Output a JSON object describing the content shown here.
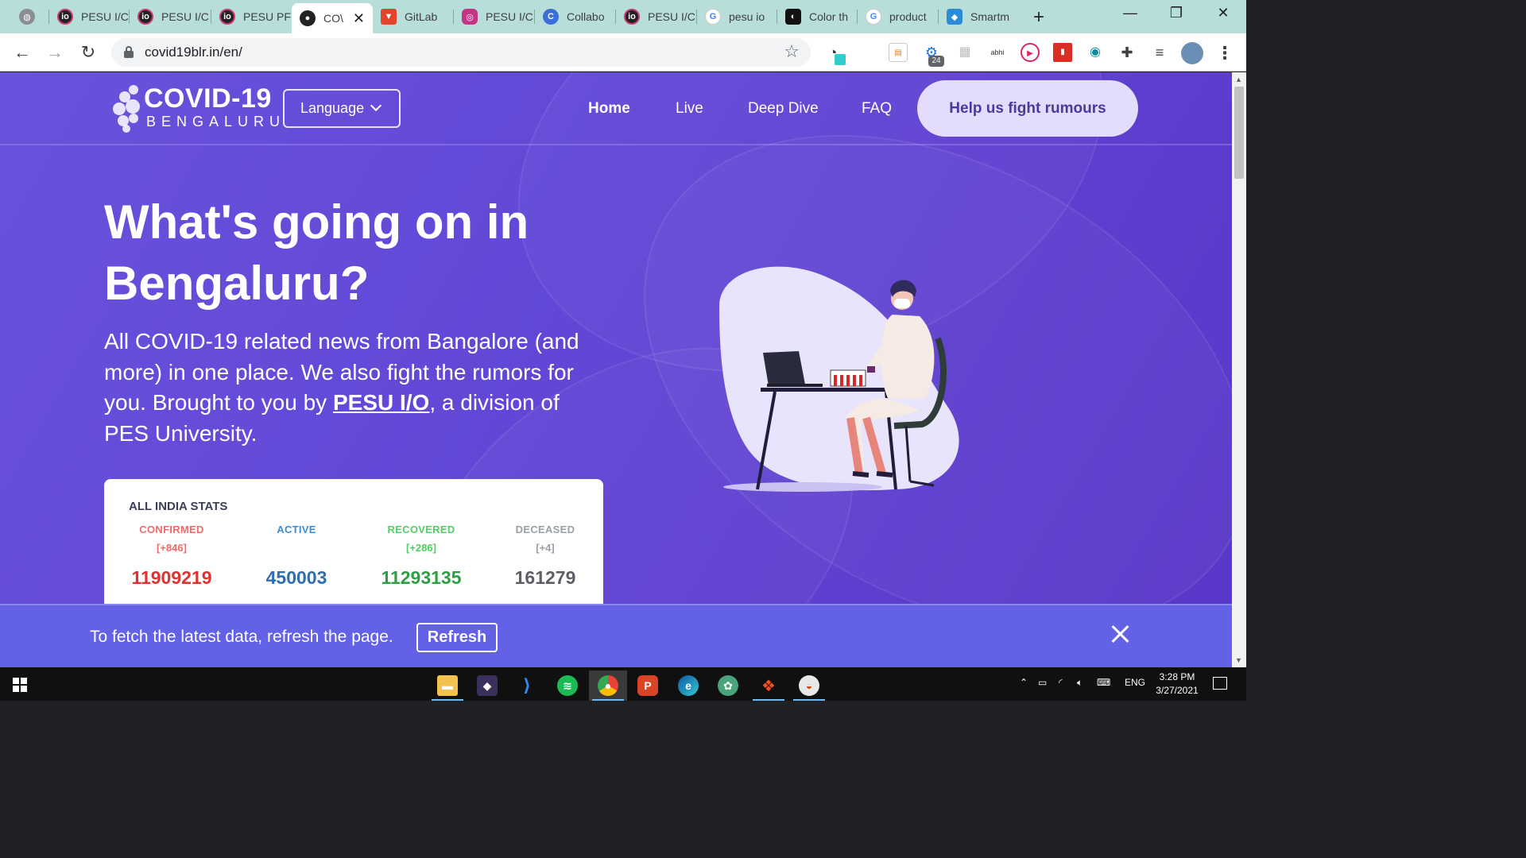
{
  "browser": {
    "tabs": [
      {
        "label": "",
        "icon": "globe-icon",
        "color": "#5f6368"
      },
      {
        "label": "PESU I/C",
        "icon": "pesu-io-icon",
        "color": "#222222"
      },
      {
        "label": "PESU I/C",
        "icon": "pesu-io-icon",
        "color": "#222222"
      },
      {
        "label": "PESU PF",
        "icon": "pesu-io-icon",
        "color": "#222222"
      },
      {
        "label": "CO\\",
        "icon": "covid-site-icon",
        "color": "#222222",
        "active": true
      },
      {
        "label": "GitLab",
        "icon": "gitlab-icon",
        "color": "#e2432a"
      },
      {
        "label": "PESU I/C",
        "icon": "instagram-icon",
        "color": "#c13584"
      },
      {
        "label": "Collabo",
        "icon": "collab-icon",
        "color": "#3b6fd8"
      },
      {
        "label": "PESU I/C",
        "icon": "pesu-io-icon",
        "color": "#222222"
      },
      {
        "label": "pesu io",
        "icon": "google-icon",
        "color": "#4285f4"
      },
      {
        "label": "Color th",
        "icon": "color-tool-icon",
        "color": "#111111"
      },
      {
        "label": "product",
        "icon": "google-icon",
        "color": "#4285f4"
      },
      {
        "label": "Smartm",
        "icon": "smartmockups-icon",
        "color": "#2a8bd6"
      }
    ],
    "url": "covid19blr.in/en/",
    "badge_count": "24"
  },
  "site": {
    "logo_title": "COVID-19",
    "logo_subtitle": "BENGALURU",
    "language_label": "Language",
    "nav": [
      "Home",
      "Live",
      "Deep Dive",
      "FAQ"
    ],
    "cta_label": "Help us fight rumours"
  },
  "hero": {
    "headline_line1": "What's going on in",
    "headline_line2": "Bengaluru?",
    "lead_before": "All COVID-19 related news from Bangalore (and more) in one place. We also fight the rumors for you. Brought to you by ",
    "lead_link": "PESU I/O",
    "lead_after": ", a division of PES University."
  },
  "stats": {
    "title": "ALL INDIA STATS",
    "items": [
      {
        "label": "CONFIRMED",
        "delta": "[+846]",
        "value": "11909219",
        "color": "#e74c3c",
        "value_color": "#e03131"
      },
      {
        "label": "ACTIVE",
        "delta": "",
        "value": "450003",
        "color": "#3b8ed6",
        "value_color": "#2f6fb0"
      },
      {
        "label": "RECOVERED",
        "delta": "[+286]",
        "value": "11293135",
        "color": "#37b24d",
        "value_color": "#2f9e44"
      },
      {
        "label": "DECEASED",
        "delta": "[+4]",
        "value": "161279",
        "color": "#868e96",
        "value_color": "#5c5f66"
      }
    ]
  },
  "refresh_bar": {
    "message": "To fetch the latest data, refresh the page.",
    "button_label": "Refresh"
  },
  "taskbar": {
    "apps": [
      "file-explorer",
      "screen-recorder",
      "vs-code",
      "spotify",
      "chrome",
      "psiphon",
      "edge",
      "chatgpt",
      "figma",
      "paint"
    ],
    "language": "ENG",
    "time": "3:28 PM",
    "date": "3/27/2021"
  },
  "colors": {
    "page_bg": "#6247d6",
    "cta_bg": "#e3dcfa",
    "refresh_bar_bg": "#6361e6"
  }
}
